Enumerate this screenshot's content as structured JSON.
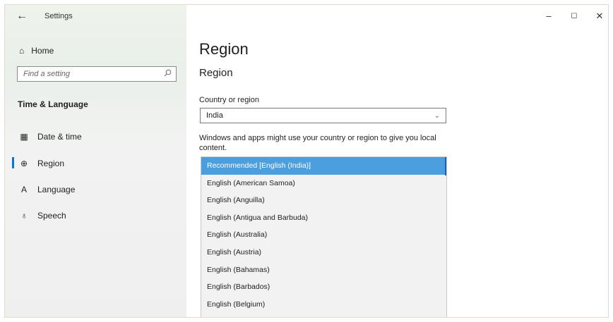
{
  "titlebar": {
    "back_icon": "back-arrow-icon",
    "title": "Settings",
    "minimize": "–",
    "maximize": "◻",
    "close": "✕"
  },
  "sidebar": {
    "home": {
      "label": "Home",
      "icon": "home-icon"
    },
    "search": {
      "placeholder": "Find a setting",
      "icon": "search-icon"
    },
    "section": "Time & Language",
    "items": [
      {
        "label": "Date & time",
        "icon": "calendar-clock-icon"
      },
      {
        "label": "Region",
        "icon": "globe-icon",
        "active": true
      },
      {
        "label": "Language",
        "icon": "language-icon"
      },
      {
        "label": "Speech",
        "icon": "microphone-icon"
      }
    ]
  },
  "main": {
    "title": "Region",
    "subtitle": "Region",
    "country_label": "Country or region",
    "country_value": "India",
    "description": "Windows and apps might use your country or region to give you local content.",
    "format_options": [
      "Recommended [English (India)]",
      "English (American Samoa)",
      "English (Anguilla)",
      "English (Antigua and Barbuda)",
      "English (Australia)",
      "English (Austria)",
      "English (Bahamas)",
      "English (Barbados)",
      "English (Belgium)"
    ]
  },
  "colors": {
    "accent": "#0078d7",
    "selected_bg": "#4c9fde"
  }
}
